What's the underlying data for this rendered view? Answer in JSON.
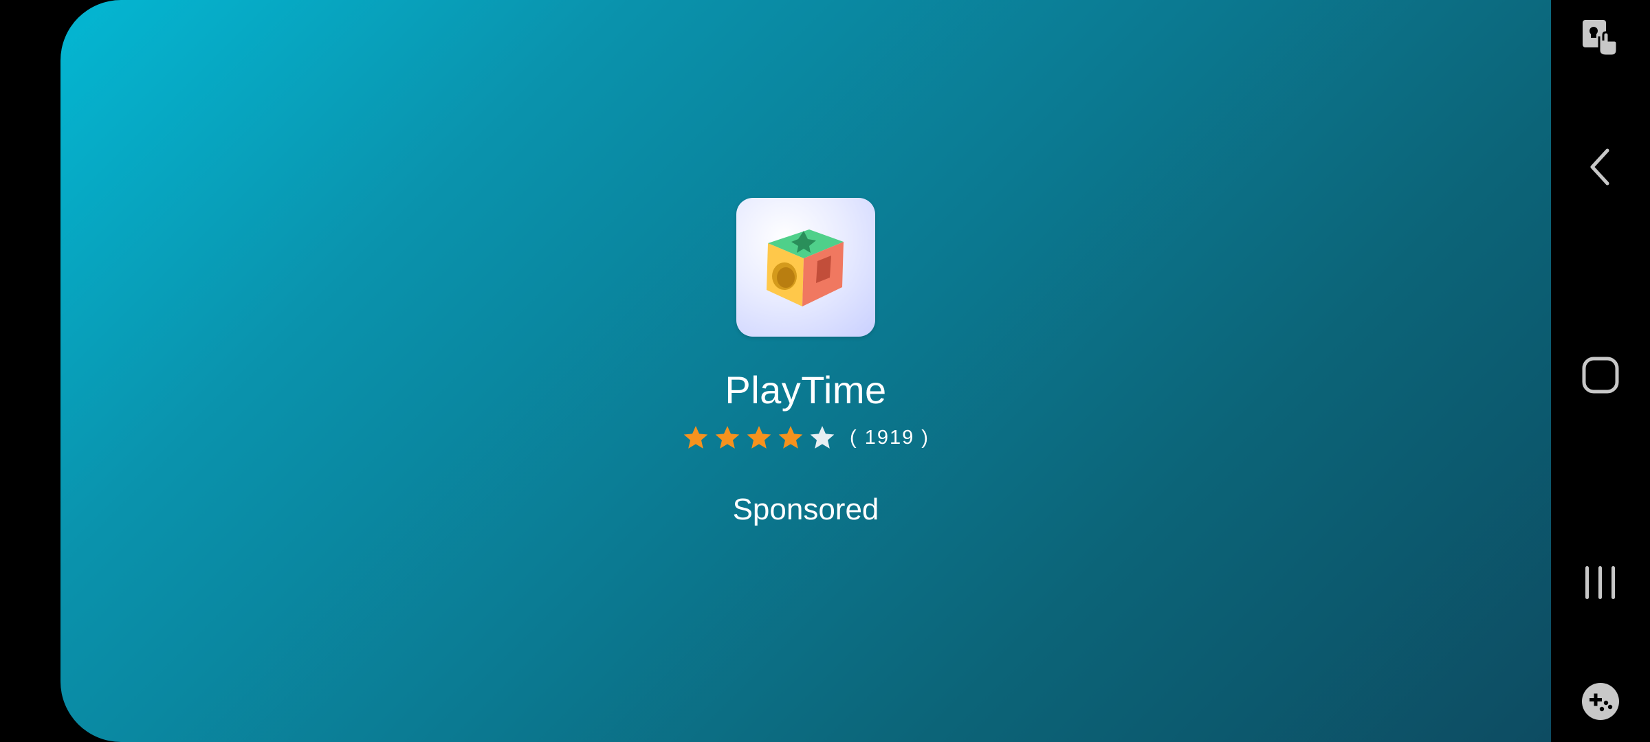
{
  "app": {
    "name": "PlayTime",
    "rating": 4,
    "rating_max": 5,
    "rating_count_text": "( 1919 )",
    "sponsored_label": "Sponsored"
  },
  "colors": {
    "star_filled": "#f6921e",
    "star_empty": "#e8eef2",
    "text": "#ffffff",
    "nav_icon": "#c8c8c8"
  },
  "icons": {
    "app_icon": "shape-sorter-cube-icon",
    "star_filled": "star-filled-icon",
    "star_empty": "star-empty-icon",
    "nav": [
      "screen-pin-touch-icon",
      "back-chevron-icon",
      "home-rounded-square-icon",
      "recent-apps-icon",
      "game-tools-icon"
    ]
  }
}
